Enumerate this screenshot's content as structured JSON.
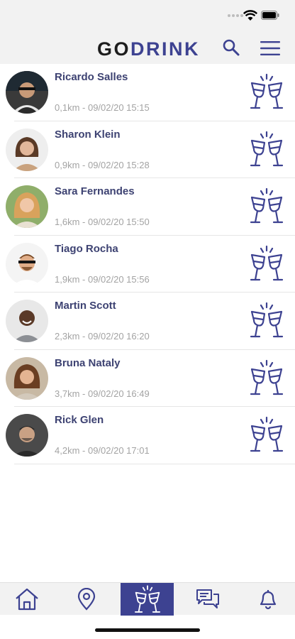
{
  "app": {
    "logo_part1": "GO",
    "logo_part2": "DRINK"
  },
  "colors": {
    "brand": "#3d4291",
    "name_text": "#3d4272",
    "meta_text": "#a3a3a3",
    "bar_bg": "#f2f2f2"
  },
  "header": {
    "search_icon": "search-icon",
    "menu_icon": "hamburger-menu-icon"
  },
  "users": [
    {
      "name": "Ricardo Salles",
      "distance": "0,1km",
      "datetime": "09/02/20 15:15"
    },
    {
      "name": "Sharon Klein",
      "distance": "0,9km",
      "datetime": "09/02/20 15:28"
    },
    {
      "name": "Sara Fernandes",
      "distance": "1,6km",
      "datetime": "09/02/20 15:50"
    },
    {
      "name": "Tiago Rocha",
      "distance": "1,9km",
      "datetime": "09/02/20 15:56"
    },
    {
      "name": "Martin Scott",
      "distance": "2,3km",
      "datetime": "09/02/20 16:20"
    },
    {
      "name": "Bruna Nataly",
      "distance": "3,7km",
      "datetime": "09/02/20 16:49"
    },
    {
      "name": "Rick Glen",
      "distance": "4,2km",
      "datetime": "09/02/20 17:01"
    }
  ],
  "tabs": [
    {
      "icon": "home-icon",
      "active": false
    },
    {
      "icon": "location-pin-icon",
      "active": false
    },
    {
      "icon": "cheers-icon",
      "active": true
    },
    {
      "icon": "chat-icon",
      "active": false
    },
    {
      "icon": "bell-icon",
      "active": false
    }
  ]
}
